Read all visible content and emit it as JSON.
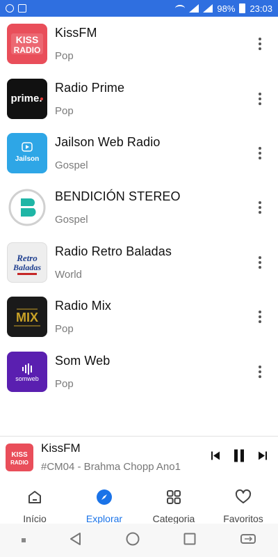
{
  "status_bar": {
    "battery": "98%",
    "time": "23:03",
    "icons": [
      "sync-icon",
      "image-icon",
      "wifi-icon",
      "signal-icon",
      "signal-icon",
      "battery-icon"
    ]
  },
  "stations": [
    {
      "name": "KissFM",
      "genre": "Pop",
      "logo": "kissfm-logo"
    },
    {
      "name": "Radio Prime",
      "genre": "Pop",
      "logo": "prime-logo"
    },
    {
      "name": "Jailson Web Radio",
      "genre": "Gospel",
      "logo": "jailson-logo"
    },
    {
      "name": "BENDICIÓN STEREO",
      "genre": "Gospel",
      "logo": "bendicion-logo"
    },
    {
      "name": "Radio Retro Baladas",
      "genre": "World",
      "logo": "retro-baladas-logo"
    },
    {
      "name": "Radio Mix",
      "genre": "Pop",
      "logo": "radio-mix-logo"
    },
    {
      "name": "Som Web",
      "genre": "Pop",
      "logo": "som-web-logo"
    }
  ],
  "logo_text": {
    "kiss_top": "KISS",
    "kiss_bottom": "RADIO",
    "prime": "prime.",
    "jailson": "Jailson",
    "retro_line1": "Retro",
    "retro_line2": "Baladas",
    "mix": "MIX",
    "somweb": "somweb"
  },
  "player": {
    "title": "KissFM",
    "subtitle": "#CM04 - Brahma Chopp Ano1"
  },
  "nav": {
    "items": [
      {
        "label": "Início",
        "icon": "home-icon"
      },
      {
        "label": "Explorar",
        "icon": "compass-icon",
        "active": true
      },
      {
        "label": "Categoria",
        "icon": "grid-icon"
      },
      {
        "label": "Favoritos",
        "icon": "heart-icon"
      }
    ]
  },
  "colors": {
    "status_bar": "#2f6fe0",
    "accent": "#1a73e8",
    "kiss_bg": "#e94e5a",
    "prime_bg": "#111111",
    "jailson_bg": "#2ea6e6",
    "bendicion_accent": "#1fb6a6",
    "retro_bg": "#eeeeee",
    "mix_bg": "#1a1a1a",
    "somweb_bg": "#5a1fb0"
  }
}
